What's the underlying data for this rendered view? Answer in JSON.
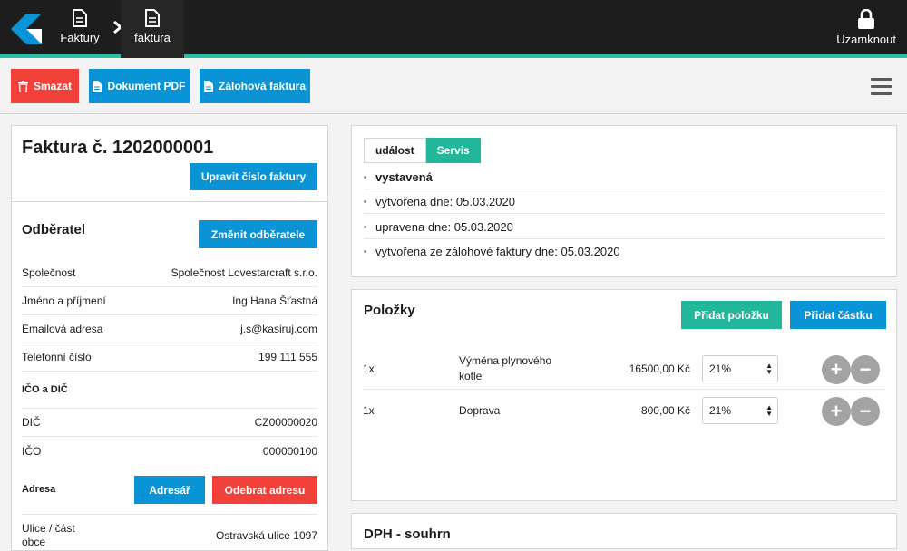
{
  "nav": {
    "breadcrumbs": [
      {
        "label": "Faktury",
        "icon": "document-icon"
      },
      {
        "label": "faktura",
        "icon": "document-icon"
      }
    ],
    "lock_label": "Uzamknout",
    "accent_color": "#2bbfa7"
  },
  "toolbar": {
    "delete_label": "Smazat",
    "pdf_label": "Dokument PDF",
    "advance_label": "Zálohová faktura"
  },
  "invoice": {
    "title": "Faktura č. 1202000001",
    "edit_number_label": "Upravit číslo faktury"
  },
  "customer": {
    "heading": "Odběratel",
    "change_label": "Změnit odběratele",
    "fields": [
      {
        "label": "Společnost",
        "value": "Společnost Lovestarcraft s.r.o."
      },
      {
        "label": "Jméno a příjmení",
        "value": "Ing.Hana Šťastná"
      },
      {
        "label": "Emailová adresa",
        "value": "j.s@kasiruj.com"
      },
      {
        "label": "Telefonní číslo",
        "value": "199 111 555"
      }
    ],
    "tax_heading": "IČO a DIČ",
    "tax_fields": [
      {
        "label": "DIČ",
        "value": "CZ00000020"
      },
      {
        "label": "IČO",
        "value": "000000100"
      }
    ],
    "address_heading": "Adresa",
    "address_book_label": "Adresář",
    "remove_address_label": "Odebrat adresu",
    "street_label": "Ulice / část obce",
    "street_value": "Ostravská ulice 1097"
  },
  "events": {
    "tabs": [
      "událost",
      "Servis"
    ],
    "items": [
      "vystavená",
      "vytvořena dne: 05.03.2020",
      "upravena dne: 05.03.2020",
      "vytvořena ze zálohové faktury dne: 05.03.2020"
    ]
  },
  "items": {
    "heading": "Položky",
    "add_item_label": "Přidat položku",
    "add_amount_label": "Přidat částku",
    "rows": [
      {
        "qty": "1x",
        "name": "Výměna plynového kotle",
        "price": "16500,00 Kč",
        "vat": "21%"
      },
      {
        "qty": "1x",
        "name": "Doprava",
        "price": "800,00 Kč",
        "vat": "21%"
      }
    ]
  },
  "vat_summary": {
    "heading": "DPH - souhrn"
  }
}
